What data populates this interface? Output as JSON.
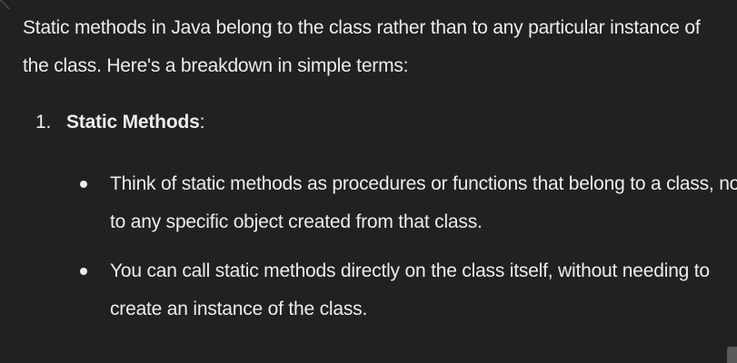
{
  "message": {
    "intro": "Static methods in Java belong to the class rather than to any particular instance of the class. Here's a breakdown in simple terms:",
    "list": [
      {
        "number": "1.",
        "heading": "Static Methods",
        "heading_suffix": ":",
        "bullets": [
          "Think of static methods as procedures or functions that belong to a class, not to any specific object created from that class.",
          "You can call static methods directly on the class itself, without needing to create an instance of the class."
        ]
      }
    ]
  },
  "colors": {
    "background": "#212121",
    "text": "#ececec"
  }
}
